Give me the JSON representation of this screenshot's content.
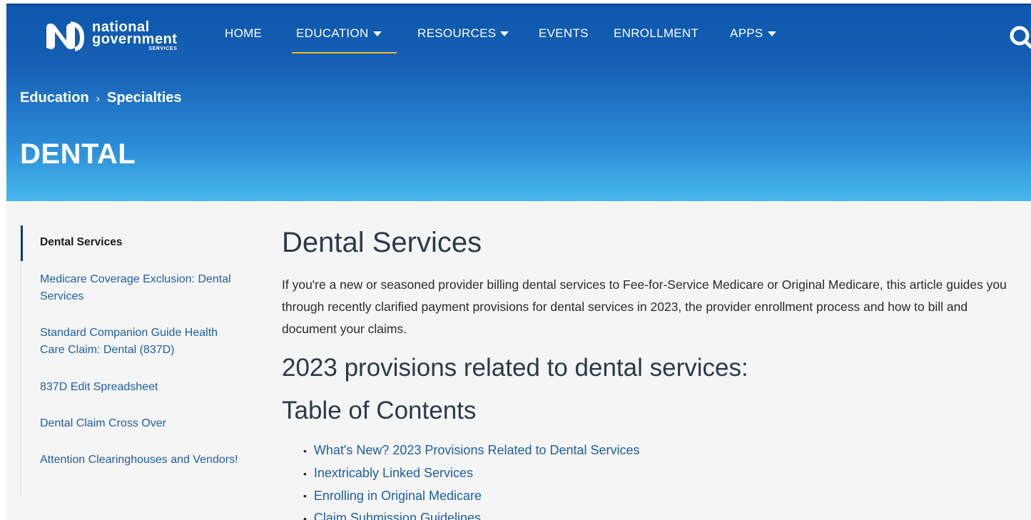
{
  "header": {
    "logo": {
      "line1": "national",
      "line2": "government",
      "line3": "SERVICES",
      "icon": "ngs-logo-icon"
    },
    "nav": [
      {
        "label": "HOME",
        "has_caret": false
      },
      {
        "label": "EDUCATION",
        "has_caret": true,
        "active": true
      },
      {
        "label": "RESOURCES",
        "has_caret": true
      },
      {
        "label": "EVENTS",
        "has_caret": false
      },
      {
        "label": "ENROLLMENT",
        "has_caret": false
      },
      {
        "label": "APPS",
        "has_caret": true
      }
    ],
    "search_icon": "search-icon",
    "active_underline_color": "#f5b824"
  },
  "breadcrumb": {
    "items": [
      "Education",
      "Specialties"
    ],
    "separator": "›"
  },
  "page_title": "DENTAL",
  "sidebar": {
    "items": [
      {
        "label": "Dental Services",
        "active": true
      },
      {
        "label": "Medicare Coverage Exclusion: Dental Services"
      },
      {
        "label": "Standard Companion Guide Health Care Claim: Dental (837D)"
      },
      {
        "label": "837D Edit Spreadsheet"
      },
      {
        "label": "Dental Claim Cross Over"
      },
      {
        "label": "Attention Clearinghouses and Vendors!"
      }
    ]
  },
  "main": {
    "heading": "Dental Services",
    "intro": "If you're a new or seasoned provider billing dental services to Fee-for-Service Medicare or Original Medicare, this article guides you through recently clarified payment provisions for dental services in 2023, the provider enrollment process and how to bill and document your claims.",
    "subheading": "2023 provisions related to dental services:",
    "toc_heading": "Table of Contents",
    "toc": [
      "What's New? 2023 Provisions Related to Dental Services",
      "Inextricably Linked Services",
      "Enrolling in Original Medicare",
      "Claim Submission Guidelines"
    ]
  },
  "colors": {
    "header_top": "#0c57ac",
    "header_bottom": "#46b8ec",
    "link": "#1d5fa3",
    "heading": "#2b3a4a",
    "content_bg": "#f5f5f5"
  }
}
